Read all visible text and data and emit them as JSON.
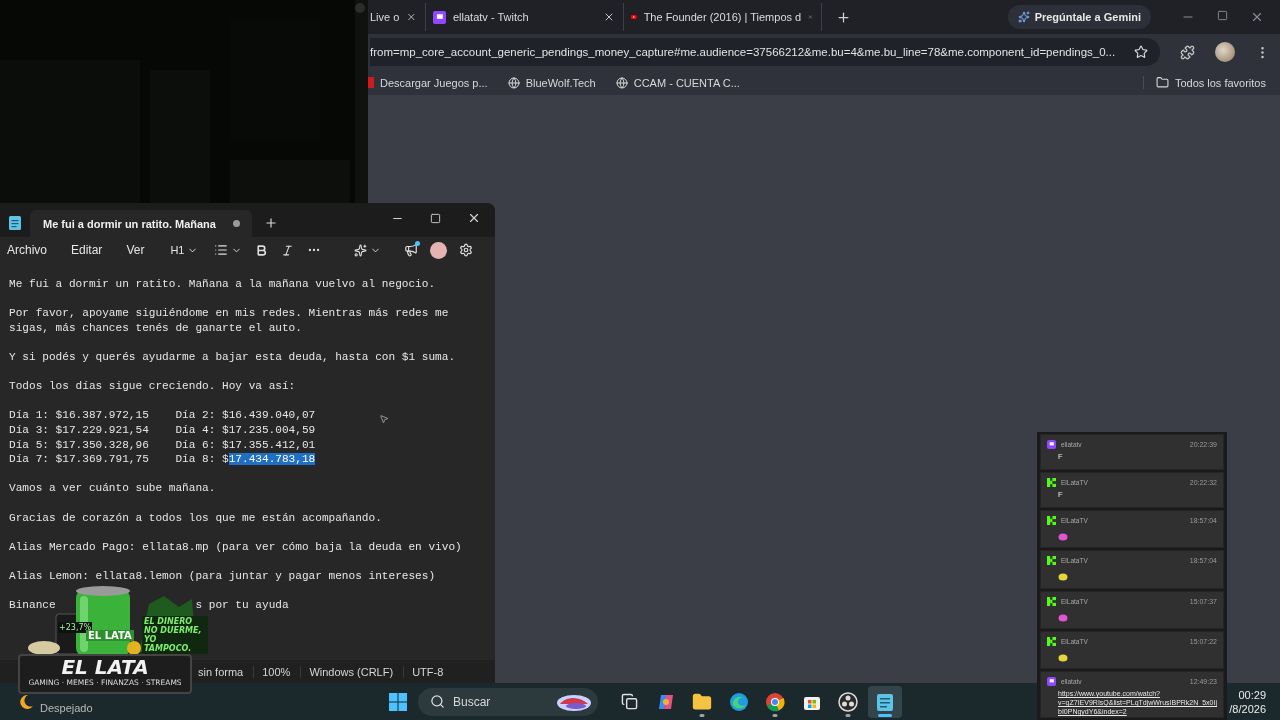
{
  "browser": {
    "tabs": [
      {
        "title": "Live o"
      },
      {
        "title": "ellatatv - Twitch",
        "favicon": {
          "kind": "twitch"
        }
      },
      {
        "title": "The Founder (2016) | Tiempos d",
        "favicon": {
          "kind": "youtube"
        }
      }
    ],
    "gemini_button": "Pregúntale a Gemini",
    "address": "from=mp_core_account_generic_pendings_money_capture#me.audience=37566212&me.bu=4&me.bu_line=78&me.component_id=pendings_0...",
    "bookmarks": [
      {
        "label": "Descargar Juegos p...",
        "kind": "game"
      },
      {
        "label": "BlueWolf.Tech",
        "kind": "globe"
      },
      {
        "label": "CCAM - CUENTA C...",
        "kind": "globe"
      }
    ],
    "all_bookmarks": "Todos los favoritos"
  },
  "notepad": {
    "tab_title": "Me fui a dormir un ratito. Mañana",
    "unsaved": true,
    "menu": [
      "Archivo",
      "Editar",
      "Ver"
    ],
    "heading_button": "H1",
    "blocks": [
      {
        "kind": "text",
        "text": "Me fui a dormir un ratito. Mañana a la mañana vuelvo al negocio."
      },
      {
        "kind": "text",
        "text": "Por favor, apoyame siguiéndome en mis redes. Mientras más redes me sigas, más chances tenés de ganarte el auto."
      },
      {
        "kind": "text",
        "text": "Y si podés y querés ayudarme a bajar esta deuda, hasta con $1 suma."
      },
      {
        "kind": "text",
        "text": "Todos los días sigue creciendo. Hoy va así:"
      },
      {
        "kind": "days",
        "rows": [
          {
            "cells": [
              {
                "text": "Día 1: $16.387.972,15"
              },
              {
                "text": "Día 2: $16.439.040,07"
              }
            ]
          },
          {
            "cells": [
              {
                "text": "Día 3: $17.229.921,54"
              },
              {
                "text": "Día 4: $17.235.004,59"
              }
            ]
          },
          {
            "cells": [
              {
                "text": "Día 5: $17.350.328,96"
              },
              {
                "text": "Día 6: $17.355.412,01"
              }
            ]
          },
          {
            "cells": [
              {
                "text": "Día 7: $17.369.791,75"
              },
              {
                "text": "Día 8: $",
                "selection": "17.434.783,18"
              }
            ]
          }
        ]
      },
      {
        "kind": "text",
        "text": "Vamos a ver cuánto sube mañana."
      },
      {
        "kind": "text",
        "text": "Gracias de corazón a todos los que me están acompañando."
      },
      {
        "kind": "text",
        "text": "Alias Mercado Pago: ellata8.mp (para ver cómo baja la deuda en vivo)"
      },
      {
        "kind": "text",
        "text": "Alias Lemon: ellata8.lemon (para juntar y pagar menos intereses)"
      },
      {
        "kind": "split",
        "left": "Binance",
        "right": "s por tu ayuda"
      }
    ],
    "status": [
      "sin forma",
      "100%",
      "Windows (CRLF)",
      "UTF-8"
    ]
  },
  "logo": {
    "can_label": "EL LATA",
    "phone_reading": "+23,7%",
    "slogan": "EL DINERO NO DUERME, YO TAMPOCO.",
    "title": "EL LATA",
    "tagline": "GAMING · MEMES · FINANZAS · STREAMS"
  },
  "chat": {
    "messages": [
      {
        "badge": {
          "kind": "twitch"
        },
        "user": "ellatatv",
        "time": "20:22:39",
        "kind": "text",
        "text": "F"
      },
      {
        "badge": {
          "kind": "kick"
        },
        "user": "ElLataTV",
        "time": "20:22:32",
        "kind": "text",
        "text": "F"
      },
      {
        "badge": {
          "kind": "kick"
        },
        "user": "ElLataTV",
        "time": "18:57:04",
        "kind": "emote",
        "color": "#e055d0"
      },
      {
        "badge": {
          "kind": "kick"
        },
        "user": "ElLataTV",
        "time": "18:57:04",
        "kind": "emote",
        "color": "#e8d53a"
      },
      {
        "badge": {
          "kind": "kick"
        },
        "user": "ElLataTV",
        "time": "15:07:37",
        "kind": "emote",
        "color": "#e055d0"
      },
      {
        "badge": {
          "kind": "kick"
        },
        "user": "ElLataTV",
        "time": "15:07:22",
        "kind": "emote",
        "color": "#e8d53a"
      },
      {
        "badge": {
          "kind": "twitch"
        },
        "user": "ellatatv",
        "time": "12:49:23",
        "kind": "link",
        "text": "https://www.youtube.com/watch?v=gZ7IEV9RIsQ&list=PLqTdjwWrusIBPRk2N_5x0IjbI0PNgydY6&index=2"
      }
    ]
  },
  "taskbar": {
    "weather": "Despejado",
    "search_placeholder": "Buscar",
    "apps": [
      {
        "kind": "taskview",
        "running": false,
        "selected": false
      },
      {
        "kind": "copilot",
        "running": false,
        "selected": false
      },
      {
        "kind": "folder",
        "running": true,
        "selected": false
      },
      {
        "kind": "edge",
        "running": false,
        "selected": false
      },
      {
        "kind": "chrome",
        "running": true,
        "selected": false
      },
      {
        "kind": "store",
        "running": false,
        "selected": false
      },
      {
        "kind": "obs",
        "running": true,
        "selected": false
      },
      {
        "kind": "notepad",
        "running": true,
        "selected": true
      }
    ],
    "time": "00:29",
    "date": "/8/2026"
  }
}
